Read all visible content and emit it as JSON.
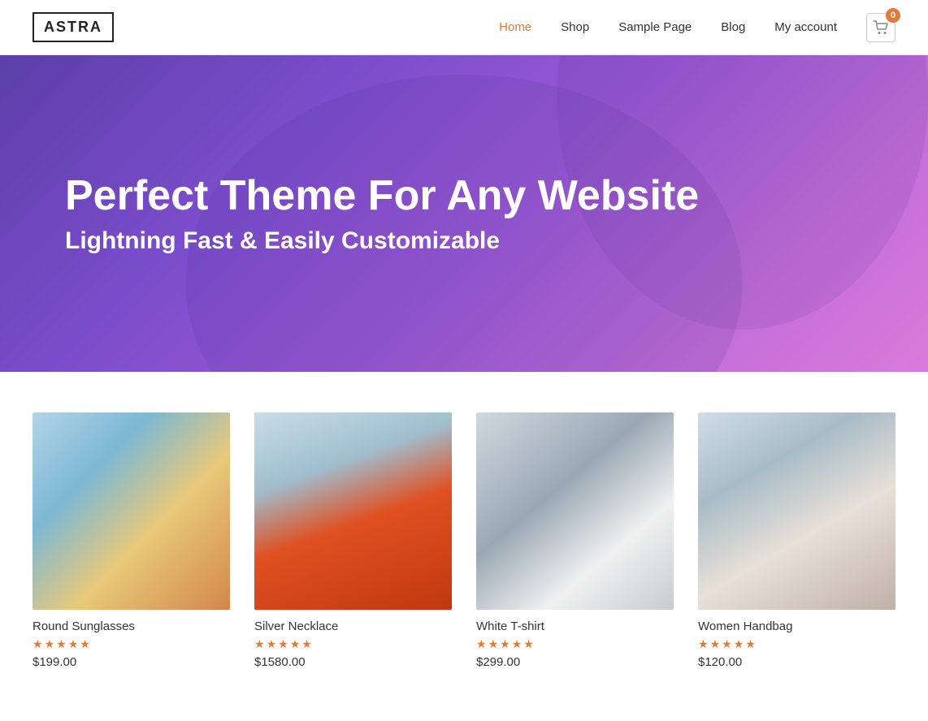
{
  "header": {
    "logo": "ASTRA",
    "nav": [
      {
        "label": "Home",
        "active": true
      },
      {
        "label": "Shop",
        "active": false
      },
      {
        "label": "Sample Page",
        "active": false
      },
      {
        "label": "Blog",
        "active": false
      },
      {
        "label": "My account",
        "active": false
      }
    ],
    "cart_count": "0"
  },
  "hero": {
    "title": "Perfect Theme For Any Website",
    "subtitle": "Lightning Fast & Easily Customizable"
  },
  "products": [
    {
      "id": 1,
      "name": "Round Sunglasses",
      "rating": 5,
      "price": "$199.00",
      "img_class": "product-img-1"
    },
    {
      "id": 2,
      "name": "Silver Necklace",
      "rating": 5,
      "price": "$1580.00",
      "img_class": "product-img-2"
    },
    {
      "id": 3,
      "name": "White T-shirt",
      "rating": 5,
      "price": "$299.00",
      "img_class": "product-img-3"
    },
    {
      "id": 4,
      "name": "Women Handbag",
      "rating": 5,
      "price": "$120.00",
      "img_class": "product-img-4"
    }
  ],
  "stars": "★★★★★"
}
